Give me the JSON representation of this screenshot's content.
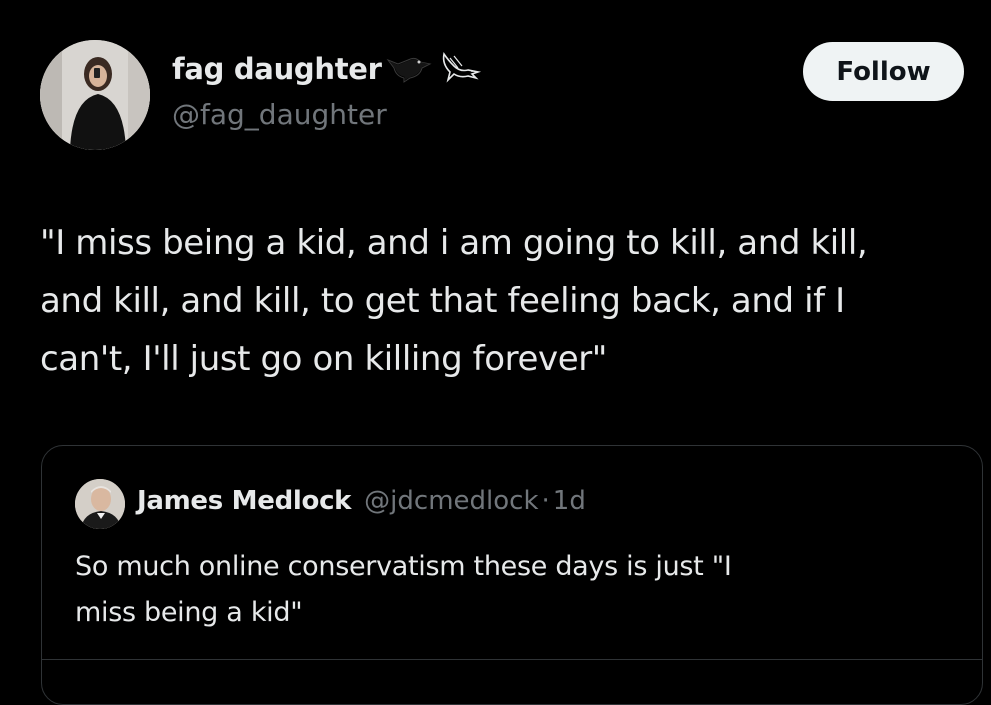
{
  "author": {
    "display_name": "fag daughter",
    "handle": "@fag_daughter",
    "name_icons": [
      "blackbird-icon",
      "crow-outline-icon"
    ]
  },
  "follow_button": {
    "label": "Follow"
  },
  "tweet": {
    "lines": [
      "\"I miss being a kid, and i am going to kill, and kill,",
      "and kill, and kill, to get that feeling back, and if I",
      "can't, I'll just go on killing forever\""
    ]
  },
  "quoted_tweet": {
    "display_name": "James Medlock",
    "handle": "@jdcmedlock",
    "separator": "·",
    "time": "1d",
    "lines": [
      "So much online conservatism these days is just \"I",
      "miss being a kid\""
    ]
  },
  "colors": {
    "background": "#000000",
    "text_primary": "#e7e9ea",
    "text_secondary": "#71767b",
    "button_bg": "#eff3f4",
    "border": "#2f3336"
  }
}
